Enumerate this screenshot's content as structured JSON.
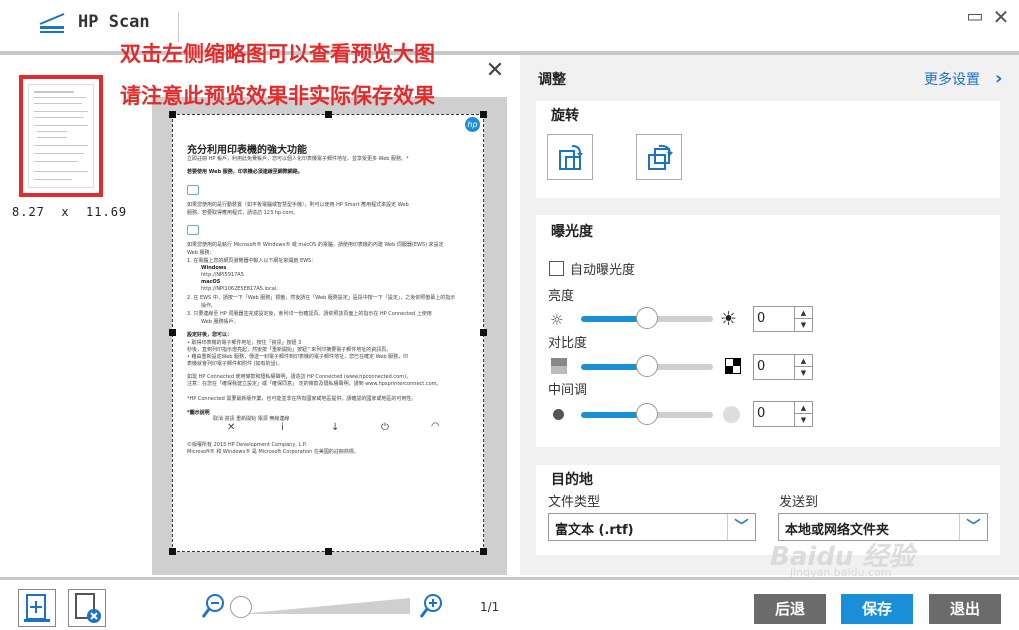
{
  "app": {
    "title": "HP Scan",
    "minimize": "▭",
    "close": "✕"
  },
  "annotation": {
    "line1": "双击左侧缩略图可以查看预览大图",
    "line2": "请注意此预览效果非实际保存效果"
  },
  "thumbnail": {
    "size": "8.27  x  11.69"
  },
  "preview": {
    "close": "✕",
    "doc": {
      "logo": "hp",
      "title": "充分利用印表機的強大功能",
      "lines": [
        "立即註冊 HP 帳戶，利用此免費帳戶，您可以個人化印表機電子郵件地址、並享受更多 Web 服務。*",
        "若要使用 Web 服務，印表機必須連線至網際網路。",
        "如果您使用的是行動裝置（如平板電腦或智慧型手機），則可以使用 HP Smart 應用程式來設定 Web",
        "服務。若要取得應用程式，請造訪 123.hp.com。",
        "如果您使用的是執行 Microsoft® Windows® 或 macOS 的電腦，請使用印表機的內建 Web 伺服器(EWS) 來設定",
        "Web 服務：",
        "1.   在電腦上您的網頁瀏覽器中輸入以下網址來開啟 EWS：",
        "Windows",
        "http://NPI5917A5",
        "macOS",
        "http://NPI1062E5E817A5.local.",
        "2.   在 EWS 中，請按一下「Web 服務」標籤，然後請在「Web 服務設定」區段中按一下「設定」，之後依照螢幕上的指示",
        "操作。",
        "3.   只要連線至 HP 伺服器並完成設定後，會列印一份確認頁。請依照該頁面上的指示在 HP Connected 上使用",
        "Web 服務帳戶。",
        "設定好後，您可以：",
        "•    取得印表機的電子郵件地址，按住「資訊」按鈕 3",
        "     秒後，直到列印指示燈亮起，然後按「重新開始」按鈕^來列印摘要電子郵件地址的資訊頁。",
        "•    藉由重新設定Web 服務，傳送一封電子郵件到印表機的電子郵件地址，您已在確定 Web 服務，印",
        "     表機就會列印電子郵件和附件 (如有的話)。",
        "如需 HP Connected 使用條款和隱私權聲明，請造訪 HP Connected (www.hpconnected.com)。",
        "注意：在您在「確保我建立設定」或「確保同意」 定的條款及隱私權聲明，請到 www.hpsprinterconnect.com。",
        "*HP Connected 需要最新版作業，也可能並非在所有國家或地區提供，請確認的國家或地區的可用性。",
        "*圖示說明",
        "取消              資訊              重新開始              電源              無線連線",
        "©版權所有 2015 HP Development Company, L.P.",
        "Microsoft® 和 Windows® 是 Microsoft Corporation 在美國的註冊商標。"
      ]
    }
  },
  "settings": {
    "heading": "调整",
    "more_settings": "更多设置",
    "rotate": {
      "title": "旋转"
    },
    "exposure": {
      "title": "曝光度",
      "auto_label": "自动曝光度",
      "auto_checked": false,
      "brightness": {
        "label": "亮度",
        "value": "0",
        "level": 0.5
      },
      "contrast": {
        "label": "对比度",
        "value": "0",
        "level": 0.5
      },
      "midtone": {
        "label": "中间调",
        "value": "0",
        "level": 0.5
      }
    },
    "destination": {
      "title": "目的地",
      "file_type_label": "文件类型",
      "file_type_value": "富文本 (.rtf)",
      "send_to_label": "发送到",
      "send_to_value": "本地或网络文件夹"
    }
  },
  "bottom": {
    "page_count": "1/1",
    "zoom_level": 0.0,
    "back": "后退",
    "save": "保存",
    "exit": "退出"
  },
  "watermark": {
    "main": "Baidu 经验",
    "sub": "jingyan.baidu.com"
  },
  "colors": {
    "accent": "#1a8fd8",
    "annotation": "#e32b2b",
    "button_gray": "#6b6b6b"
  }
}
